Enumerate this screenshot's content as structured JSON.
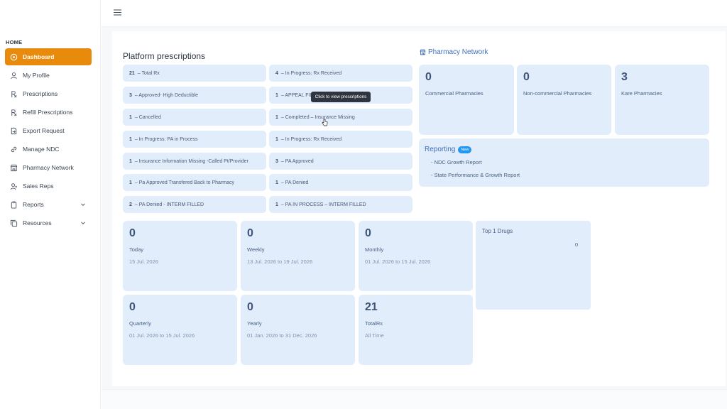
{
  "sidebar": {
    "home_label": "HOME",
    "items": [
      {
        "label": "Dashboard",
        "icon": "dashboard-icon"
      },
      {
        "label": "My Profile",
        "icon": "user-icon"
      },
      {
        "label": "Prescriptions",
        "icon": "rx-icon"
      },
      {
        "label": "Refill Prescriptions",
        "icon": "rx-icon"
      },
      {
        "label": "Export Request",
        "icon": "export-icon"
      },
      {
        "label": "Manage NDC",
        "icon": "link-icon"
      },
      {
        "label": "Pharmacy Network",
        "icon": "store-icon"
      },
      {
        "label": "Sales Reps",
        "icon": "user-plus-icon"
      },
      {
        "label": "Reports",
        "icon": "clipboard-icon"
      },
      {
        "label": "Resources",
        "icon": "copy-icon"
      }
    ]
  },
  "platform": {
    "title": "Platform prescriptions",
    "left": [
      {
        "count": "21",
        "label": "– Total Rx"
      },
      {
        "count": "3",
        "label": "– Approved- High Deductible"
      },
      {
        "count": "1",
        "label": "– Cancelled"
      },
      {
        "count": "1",
        "label": "– In Progress: PA in Process"
      },
      {
        "count": "1",
        "label": "– Insurance Information Missing -Called Pt/Provider"
      },
      {
        "count": "1",
        "label": "– Pa Approved Transfered Back to Pharmacy"
      },
      {
        "count": "2",
        "label": "– PA Denied - INTERM FILLED"
      }
    ],
    "right": [
      {
        "count": "4",
        "label": "– In Progress: Rx Received"
      },
      {
        "count": "1",
        "label": "– APPEAL FIL"
      },
      {
        "count": "1",
        "label": "– Completed – Insurance Missing"
      },
      {
        "count": "1",
        "label": "– In Progress: Rx Received"
      },
      {
        "count": "3",
        "label": "– PA Approved"
      },
      {
        "count": "1",
        "label": "– PA Denied"
      },
      {
        "count": "1",
        "label": "– PA IN PROCESS – INTERM FILLED"
      }
    ],
    "tooltip": "Click to view prescriptions"
  },
  "network": {
    "title": "Pharmacy Network",
    "cards": [
      {
        "value": "0",
        "label": "Commercial Pharmacies"
      },
      {
        "value": "0",
        "label": "Non-commercial Pharmacies"
      },
      {
        "value": "3",
        "label": "Kare Pharmacies"
      }
    ]
  },
  "reporting": {
    "title": "Reporting",
    "badge": "New",
    "links": [
      "- NDC Growth Report",
      "- State Performance & Growth Report"
    ]
  },
  "stats": [
    {
      "value": "0",
      "label": "Today",
      "range": "15 Jul. 2026"
    },
    {
      "value": "0",
      "label": "Weekly",
      "range": "13 Jul. 2026 to 19 Jul. 2026"
    },
    {
      "value": "0",
      "label": "Monthly",
      "range": "01 Jul. 2026 to 15 Jul. 2026"
    },
    {
      "value": "0",
      "label": "Quarterly",
      "range": "01 Jul. 2026 to 15 Jul. 2026"
    },
    {
      "value": "0",
      "label": "Yearly",
      "range": "01 Jan. 2026 to 31 Dec. 2026"
    },
    {
      "value": "21",
      "label": "TotalRx",
      "range": "All Time"
    }
  ],
  "drugs": {
    "title": "Top 1 Drugs",
    "value": "0"
  },
  "colors": {
    "accent": "#e88a0c",
    "card_bg": "#e1edfb",
    "link_blue": "#3f6fb8"
  }
}
